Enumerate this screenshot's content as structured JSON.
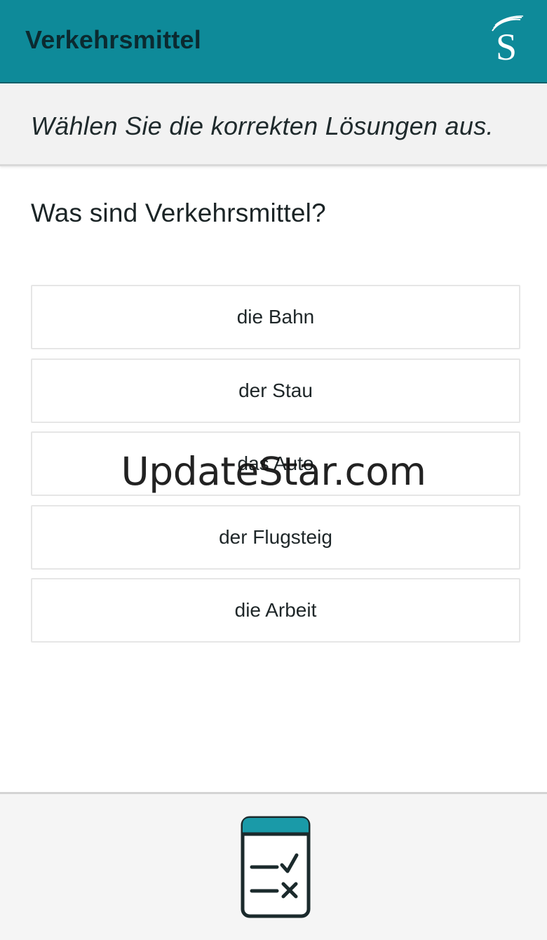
{
  "header": {
    "title": "Verkehrsmittel",
    "logo_letter": "S",
    "background_color": "#0e8a99"
  },
  "instruction": {
    "text": "Wählen Sie die korrekten Lösungen aus."
  },
  "question": {
    "text": "Was sind Verkehrsmittel?"
  },
  "options": [
    {
      "label": "die Bahn"
    },
    {
      "label": "der Stau"
    },
    {
      "label": "das Auto"
    },
    {
      "label": "der Flugsteig"
    },
    {
      "label": "die Arbeit"
    }
  ],
  "watermark": {
    "text": "UpdateStar.com"
  },
  "footer": {
    "check_icon": "checklist-icon",
    "accent_color": "#1a9aa8"
  }
}
